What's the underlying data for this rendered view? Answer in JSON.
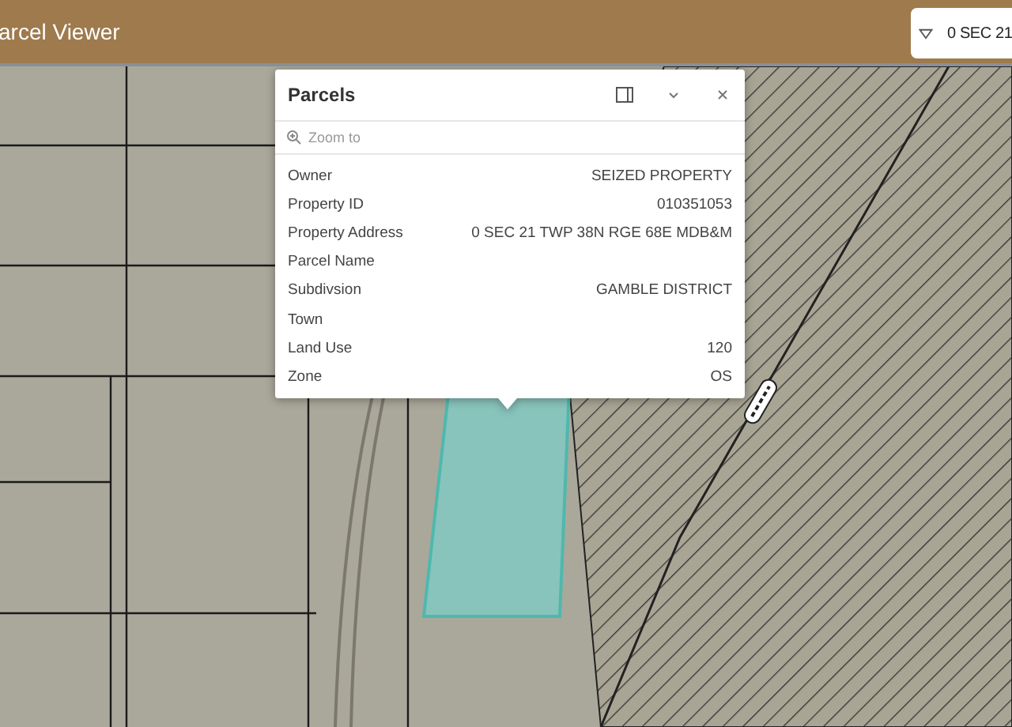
{
  "header": {
    "title": "arcel Viewer"
  },
  "search": {
    "value": "0 SEC 21"
  },
  "popup": {
    "title": "Parcels",
    "zoom_placeholder": "Zoom to",
    "fields": [
      {
        "label": "Owner",
        "value": "SEIZED PROPERTY"
      },
      {
        "label": "Property ID",
        "value": "010351053"
      },
      {
        "label": "Property Address",
        "value": "0 SEC 21 TWP 38N RGE 68E MDB&M"
      },
      {
        "label": "Parcel Name"
      },
      {
        "label": "Subdivsion",
        "value": "GAMBLE DISTRICT"
      },
      {
        "label": "Town"
      },
      {
        "label": "Land Use",
        "value": "120"
      },
      {
        "label": "Zone",
        "value": "OS"
      }
    ]
  }
}
